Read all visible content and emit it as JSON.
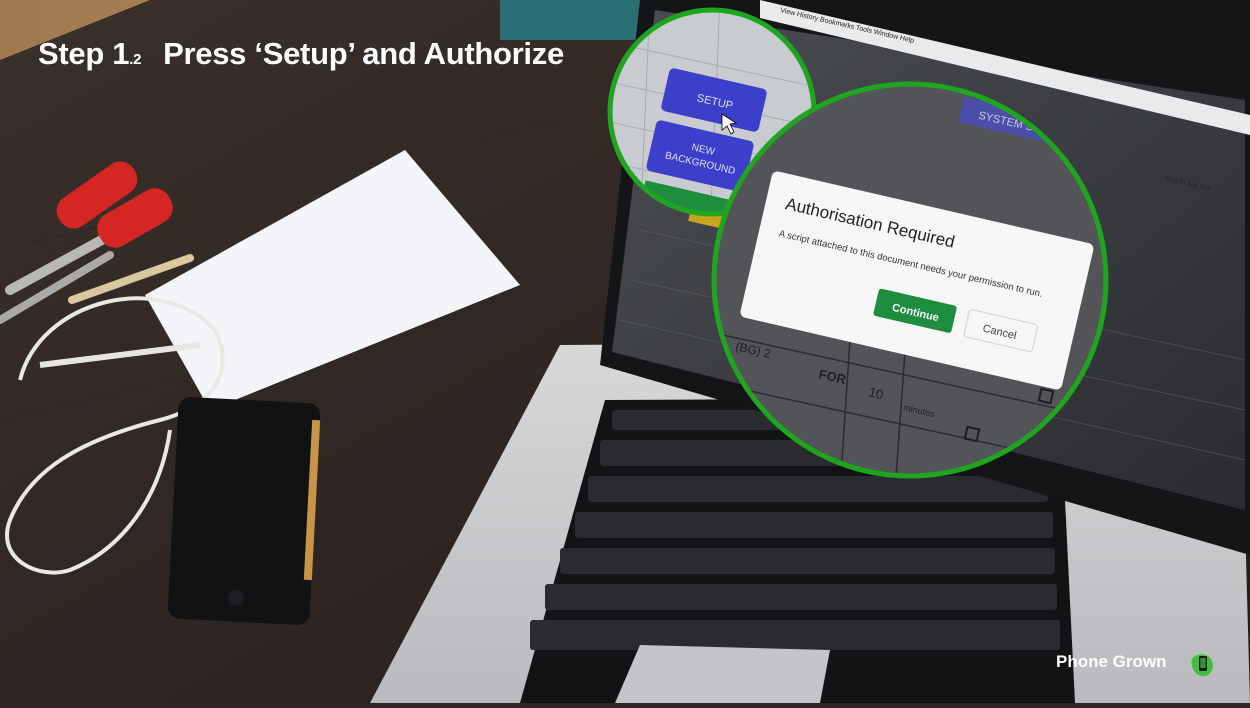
{
  "header": {
    "step": "Step 1",
    "step_sub": ".2",
    "title": "Press ‘Setup’ and Authorize"
  },
  "zoom_left": {
    "setup_button": "SETUP",
    "new_background_line1": "NEW",
    "new_background_line2": "BACKGROUND"
  },
  "zoom_right": {
    "system_status": "SYSTEM STATUS",
    "dialog_title": "Authorisation Required",
    "dialog_message": "A script attached to this document needs your permission to run.",
    "continue_label": "Continue",
    "cancel_label": "Cancel",
    "cell_bg": "(BG) 2",
    "cell_for": "FOR",
    "cell_number": "10",
    "cell_minutes": "minutes"
  },
  "screen": {
    "menu_items": [
      "View",
      "History",
      "Bookmarks",
      "Tools",
      "Window",
      "Help"
    ],
    "clock": "Wed 23 Sep  14:0"
  },
  "brand": {
    "name": "Phone Grown"
  },
  "colors": {
    "highlight_ring": "#1fa51f",
    "setup_button": "#3b3fc9",
    "continue_button": "#1e8e3e",
    "table": "#2b2320"
  }
}
